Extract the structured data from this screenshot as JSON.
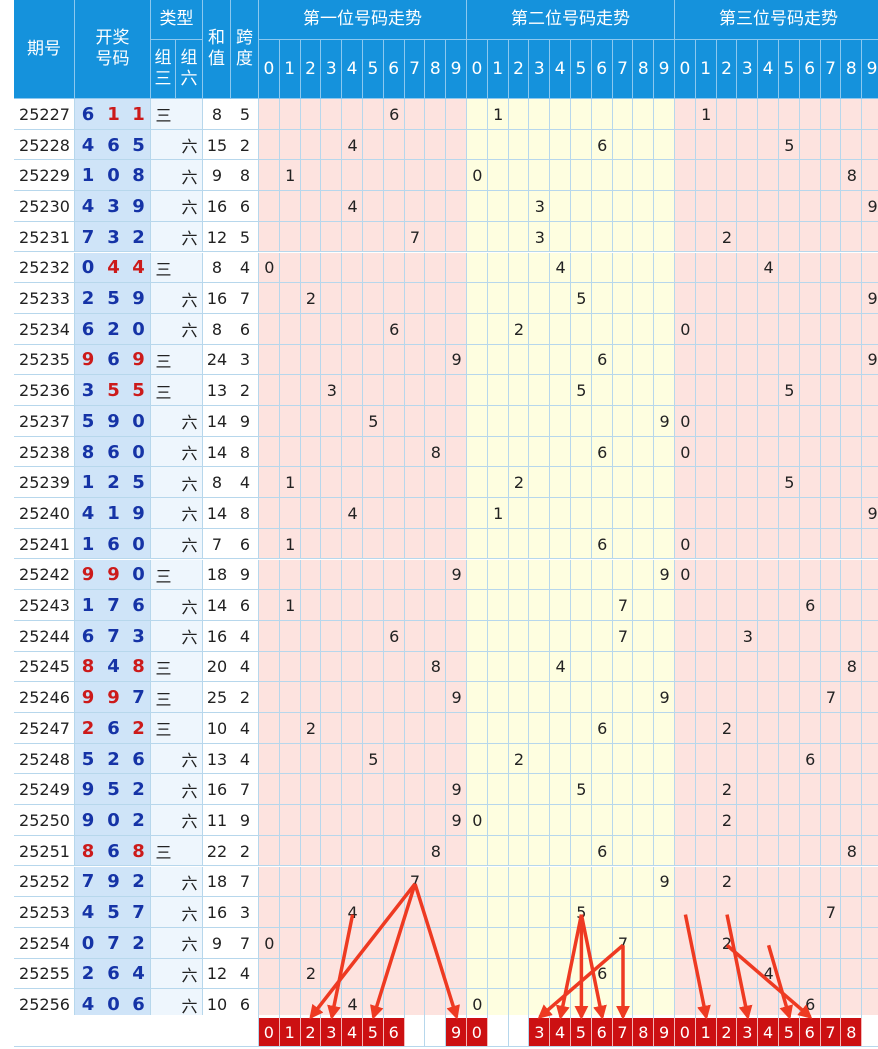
{
  "header": {
    "issue": "期号",
    "draw": "开奖号码",
    "type": "类型",
    "group3": "组三",
    "group6": "组六",
    "sum": "和值",
    "span": "跨度",
    "pos1": "第一位号码走势",
    "pos2": "第二位号码走势",
    "pos3": "第三位号码走势",
    "digits": [
      "0",
      "1",
      "2",
      "3",
      "4",
      "5",
      "6",
      "7",
      "8",
      "9"
    ]
  },
  "colors": {
    "header_bg": "#1592dc",
    "pos1_bg": "#fde3df",
    "pos2_bg": "#fefee0",
    "pos3_bg": "#fde3df",
    "draw_bg": "#cfe4f8",
    "number_blue": "#1533a6",
    "number_red": "#cc1a1a",
    "selection_red": "#cc1012",
    "arrow_red": "#ee3a22"
  },
  "chart_data": {
    "type": "table",
    "columns": [
      "期号",
      "开奖号码",
      "类型",
      "和值",
      "跨度"
    ],
    "rows": [
      {
        "issue": "25227",
        "digits": [
          6,
          1,
          1
        ],
        "type": "三",
        "sum": 8,
        "span": 5
      },
      {
        "issue": "25228",
        "digits": [
          4,
          6,
          5
        ],
        "type": "六",
        "sum": 15,
        "span": 2
      },
      {
        "issue": "25229",
        "digits": [
          1,
          0,
          8
        ],
        "type": "六",
        "sum": 9,
        "span": 8
      },
      {
        "issue": "25230",
        "digits": [
          4,
          3,
          9
        ],
        "type": "六",
        "sum": 16,
        "span": 6
      },
      {
        "issue": "25231",
        "digits": [
          7,
          3,
          2
        ],
        "type": "六",
        "sum": 12,
        "span": 5
      },
      {
        "issue": "25232",
        "digits": [
          0,
          4,
          4
        ],
        "type": "三",
        "sum": 8,
        "span": 4
      },
      {
        "issue": "25233",
        "digits": [
          2,
          5,
          9
        ],
        "type": "六",
        "sum": 16,
        "span": 7
      },
      {
        "issue": "25234",
        "digits": [
          6,
          2,
          0
        ],
        "type": "六",
        "sum": 8,
        "span": 6
      },
      {
        "issue": "25235",
        "digits": [
          9,
          6,
          9
        ],
        "type": "三",
        "sum": 24,
        "span": 3
      },
      {
        "issue": "25236",
        "digits": [
          3,
          5,
          5
        ],
        "type": "三",
        "sum": 13,
        "span": 2
      },
      {
        "issue": "25237",
        "digits": [
          5,
          9,
          0
        ],
        "type": "六",
        "sum": 14,
        "span": 9
      },
      {
        "issue": "25238",
        "digits": [
          8,
          6,
          0
        ],
        "type": "六",
        "sum": 14,
        "span": 8
      },
      {
        "issue": "25239",
        "digits": [
          1,
          2,
          5
        ],
        "type": "六",
        "sum": 8,
        "span": 4
      },
      {
        "issue": "25240",
        "digits": [
          4,
          1,
          9
        ],
        "type": "六",
        "sum": 14,
        "span": 8
      },
      {
        "issue": "25241",
        "digits": [
          1,
          6,
          0
        ],
        "type": "六",
        "sum": 7,
        "span": 6
      },
      {
        "issue": "25242",
        "digits": [
          9,
          9,
          0
        ],
        "type": "三",
        "sum": 18,
        "span": 9
      },
      {
        "issue": "25243",
        "digits": [
          1,
          7,
          6
        ],
        "type": "六",
        "sum": 14,
        "span": 6
      },
      {
        "issue": "25244",
        "digits": [
          6,
          7,
          3
        ],
        "type": "六",
        "sum": 16,
        "span": 4
      },
      {
        "issue": "25245",
        "digits": [
          8,
          4,
          8
        ],
        "type": "三",
        "sum": 20,
        "span": 4
      },
      {
        "issue": "25246",
        "digits": [
          9,
          9,
          7
        ],
        "type": "三",
        "sum": 25,
        "span": 2
      },
      {
        "issue": "25247",
        "digits": [
          2,
          6,
          2
        ],
        "type": "三",
        "sum": 10,
        "span": 4
      },
      {
        "issue": "25248",
        "digits": [
          5,
          2,
          6
        ],
        "type": "六",
        "sum": 13,
        "span": 4
      },
      {
        "issue": "25249",
        "digits": [
          9,
          5,
          2
        ],
        "type": "六",
        "sum": 16,
        "span": 7
      },
      {
        "issue": "25250",
        "digits": [
          9,
          0,
          2
        ],
        "type": "六",
        "sum": 11,
        "span": 9
      },
      {
        "issue": "25251",
        "digits": [
          8,
          6,
          8
        ],
        "type": "三",
        "sum": 22,
        "span": 2
      },
      {
        "issue": "25252",
        "digits": [
          7,
          9,
          2
        ],
        "type": "六",
        "sum": 18,
        "span": 7
      },
      {
        "issue": "25253",
        "digits": [
          4,
          5,
          7
        ],
        "type": "六",
        "sum": 16,
        "span": 3
      },
      {
        "issue": "25254",
        "digits": [
          0,
          7,
          2
        ],
        "type": "六",
        "sum": 9,
        "span": 7
      },
      {
        "issue": "25255",
        "digits": [
          2,
          6,
          4
        ],
        "type": "六",
        "sum": 12,
        "span": 4
      },
      {
        "issue": "25256",
        "digits": [
          4,
          0,
          6
        ],
        "type": "六",
        "sum": 10,
        "span": 6
      }
    ],
    "selection": {
      "pos1": [
        0,
        1,
        2,
        3,
        4,
        5,
        6,
        9
      ],
      "pos2": [
        0,
        3,
        4,
        5,
        6,
        7,
        8,
        9
      ],
      "pos3": [
        0,
        1,
        2,
        3,
        4,
        5,
        6,
        7,
        8
      ]
    },
    "arrows": [
      {
        "from": {
          "row": 25,
          "pos": 1,
          "digit": 7
        },
        "to": {
          "pos": 1,
          "digit": 2
        }
      },
      {
        "from": {
          "row": 25,
          "pos": 1,
          "digit": 7
        },
        "to": {
          "pos": 1,
          "digit": 5
        }
      },
      {
        "from": {
          "row": 25,
          "pos": 1,
          "digit": 7
        },
        "to": {
          "pos": 1,
          "digit": 9
        }
      },
      {
        "from": {
          "row": 26,
          "pos": 1,
          "digit": 4
        },
        "to": {
          "pos": 1,
          "digit": 3
        }
      },
      {
        "from": {
          "row": 27,
          "pos": 2,
          "digit": 7
        },
        "to": {
          "pos": 2,
          "digit": 3
        }
      },
      {
        "from": {
          "row": 26,
          "pos": 2,
          "digit": 5
        },
        "to": {
          "pos": 2,
          "digit": 4
        }
      },
      {
        "from": {
          "row": 26,
          "pos": 2,
          "digit": 5
        },
        "to": {
          "pos": 2,
          "digit": 5
        }
      },
      {
        "from": {
          "row": 26,
          "pos": 2,
          "digit": 5
        },
        "to": {
          "pos": 2,
          "digit": 6
        }
      },
      {
        "from": {
          "row": 27,
          "pos": 2,
          "digit": 7
        },
        "to": {
          "pos": 2,
          "digit": 7
        }
      },
      {
        "from": {
          "row": 26,
          "pos": 3,
          "digit": 0
        },
        "to": {
          "pos": 3,
          "digit": 1
        }
      },
      {
        "from": {
          "row": 26,
          "pos": 3,
          "digit": 2
        },
        "to": {
          "pos": 3,
          "digit": 3
        }
      },
      {
        "from": {
          "row": 27,
          "pos": 3,
          "digit": 4
        },
        "to": {
          "pos": 3,
          "digit": 5
        }
      },
      {
        "from": {
          "row": 27,
          "pos": 3,
          "digit": 2
        },
        "to": {
          "pos": 3,
          "digit": 6
        }
      }
    ]
  }
}
